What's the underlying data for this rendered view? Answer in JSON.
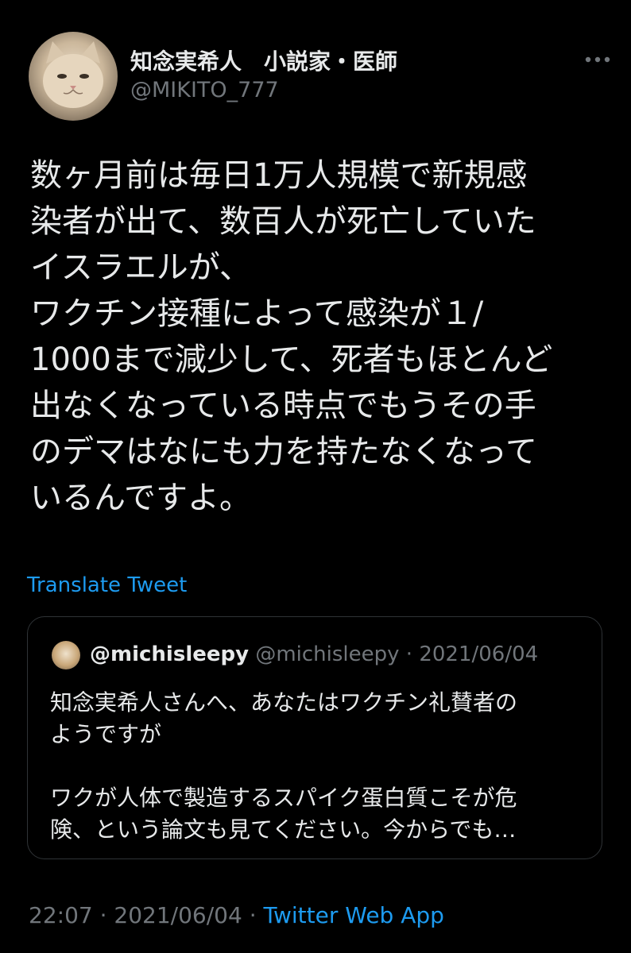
{
  "author": {
    "display_name": "知念実希人　小説家・医師",
    "handle": "@MIKITO_777",
    "avatar_icon": "cat-avatar"
  },
  "more_icon": "more-horizontal-icon",
  "tweet": {
    "lines": [
      "数ヶ月前は毎日1万人規模で新規感",
      "染者が出て、数百人が死亡していた",
      "イスラエルが、",
      "ワクチン接種によって感染が１/",
      "1000まで減少して、死者もほとんど",
      "出なくなっている時点でもうその手",
      "のデマはなにも力を持たなくなって",
      "いるんですよ。"
    ]
  },
  "translate_label": "Translate Tweet",
  "quote": {
    "avatar_icon": "dog-avatar",
    "name": "@michisleepy",
    "handle": "@michisleepy",
    "dot": "·",
    "date": "2021/06/04",
    "lines": [
      "知念実希人さんへ、あなたはワクチン礼賛者の",
      "ようですが",
      "",
      "ワクが人体で製造するスパイク蛋白質こそが危",
      "険、という論文も見てください。今からでも…"
    ]
  },
  "meta": {
    "time": "22:07",
    "sep1": "·",
    "date": "2021/06/04",
    "sep2": "·",
    "source": "Twitter Web App"
  },
  "colors": {
    "background": "#000000",
    "text": "#e7e9ea",
    "secondary": "#71767b",
    "link": "#1d9bf0",
    "border": "#2f3336"
  }
}
